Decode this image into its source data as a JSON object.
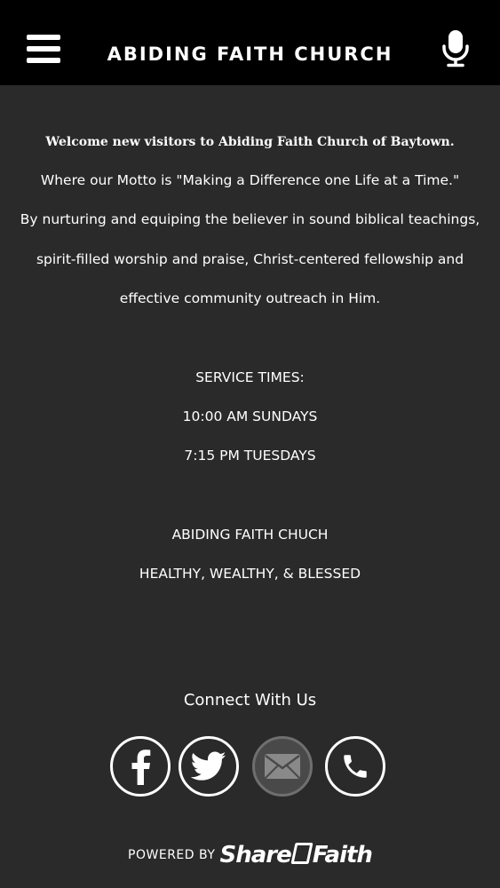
{
  "header": {
    "title": "ABIDING FAITH CHURCH",
    "menu_icon": "hamburger-menu-icon",
    "mic_icon": "microphone-icon"
  },
  "main": {
    "welcome": "Welcome new visitors to Abiding Faith Church of Baytown.",
    "motto": "Where our Motto is \"Making a Difference one Life at a Time.\"",
    "mission_lines": [
      "By nurturing and equiping the believer in sound biblical teachings,",
      "spirit-filled worship and praise, Christ-centered fellowship and",
      "effective community outreach in Him."
    ],
    "service_heading": "SERVICE TIMES:",
    "service_times": [
      "10:00 AM SUNDAYS",
      "7:15 PM TUESDAYS"
    ],
    "tagline_lines": [
      "ABIDING FAITH CHUCH",
      "HEALTHY, WEALTHY, & BLESSED"
    ]
  },
  "connect": {
    "heading": "Connect With Us",
    "icons": [
      "facebook-icon",
      "twitter-icon",
      "email-icon",
      "phone-icon"
    ]
  },
  "footer": {
    "powered_by": "POWERED BY",
    "brand_part1": "Share",
    "brand_part2": "Faith"
  },
  "colors": {
    "background": "#2b2a2b",
    "header": "#000000",
    "text": "#ffffff",
    "email_circle": "#4a494a"
  }
}
